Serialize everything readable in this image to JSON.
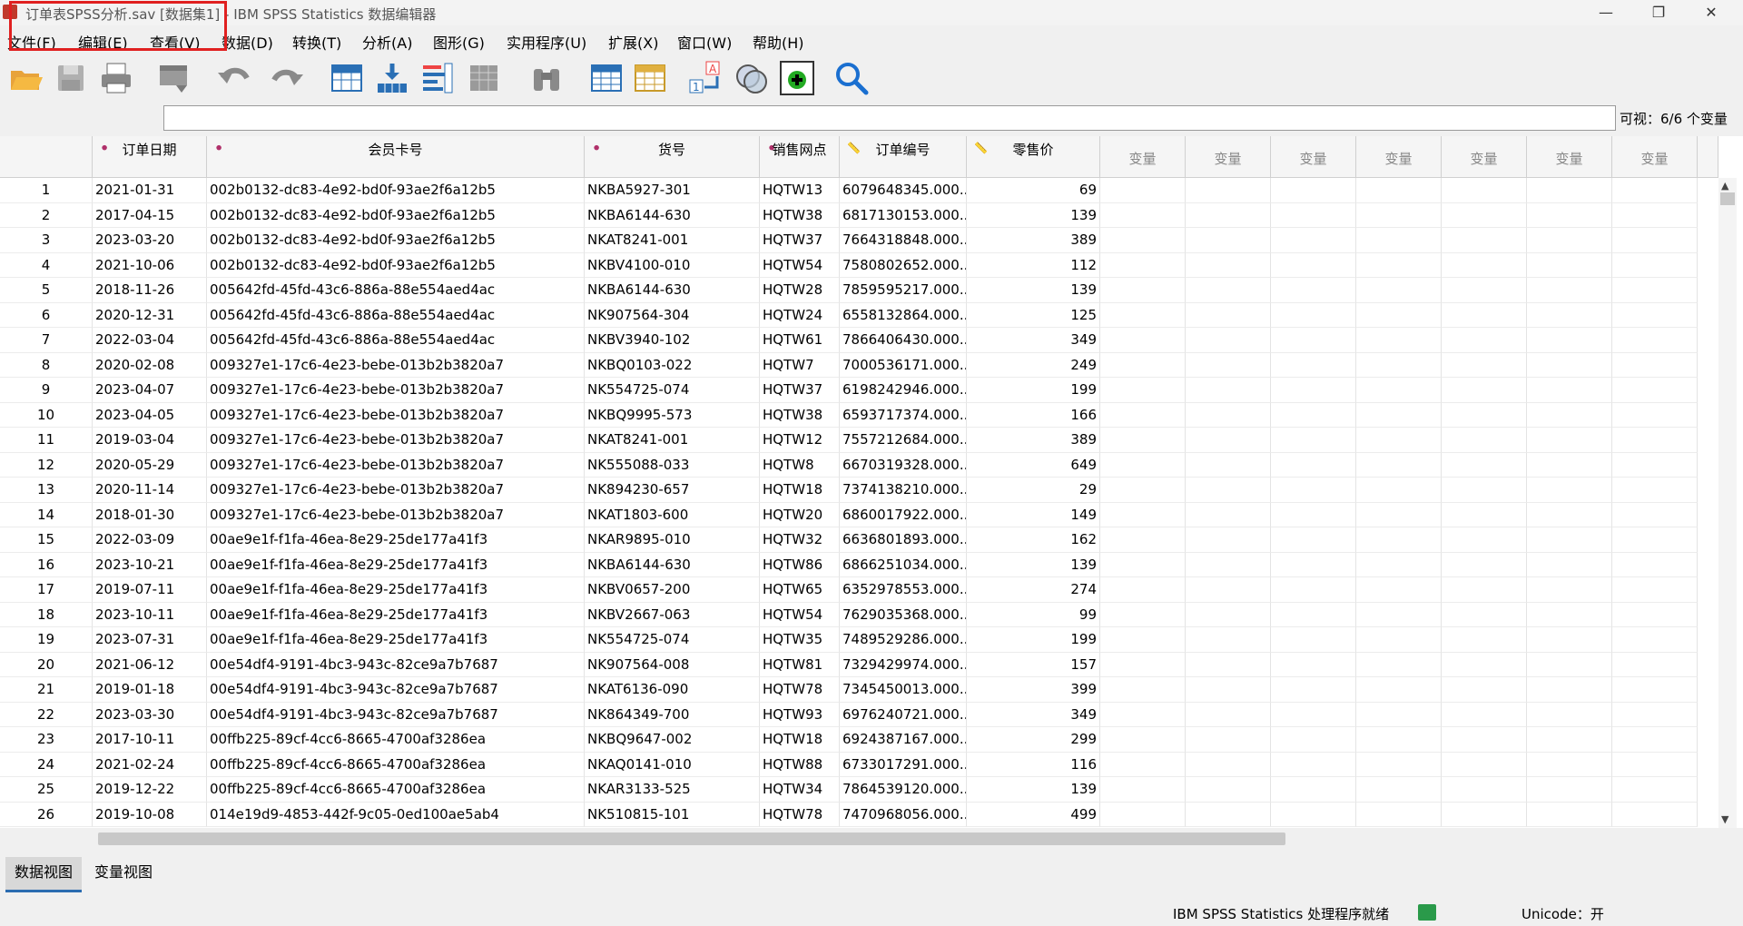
{
  "window": {
    "title": "订单表SPSS分析.sav [数据集1] - IBM SPSS Statistics 数据编辑器",
    "min": "—",
    "restore": "❐",
    "close": "✕"
  },
  "menu": [
    "文件(F)",
    "编辑(E)",
    "查看(V)",
    "数据(D)",
    "转换(T)",
    "分析(A)",
    "图形(G)",
    "实用程序(U)",
    "扩展(X)",
    "窗口(W)",
    "帮助(H)"
  ],
  "toolbar_icons": [
    "open-icon",
    "save-icon",
    "print-icon",
    "dialog-recall-icon",
    "undo-icon",
    "redo-icon",
    "goto-case-icon",
    "goto-variable-icon",
    "variables-icon",
    "run-descriptives-icon",
    "find-icon",
    "insert-cases-icon",
    "insert-variable-icon",
    "value-labels-icon",
    "split-file-icon",
    "use-sets-icon",
    "search-icon"
  ],
  "visible_count": "可视：6/6 个变量",
  "columns": [
    {
      "name": "订单日期",
      "type": "nominal"
    },
    {
      "name": "会员卡号",
      "type": "nominal"
    },
    {
      "name": "货号",
      "type": "nominal"
    },
    {
      "name": "销售网点",
      "type": "nominal"
    },
    {
      "name": "订单编号",
      "type": "scale"
    },
    {
      "name": "零售价",
      "type": "scale"
    }
  ],
  "empty_column_label": "变量",
  "rows": [
    [
      "1",
      "2021-01-31",
      "002b0132-dc83-4e92-bd0f-93ae2f6a12b5",
      "NKBA5927-301",
      "HQTW13",
      "6079648345.000...",
      "69"
    ],
    [
      "2",
      "2017-04-15",
      "002b0132-dc83-4e92-bd0f-93ae2f6a12b5",
      "NKBA6144-630",
      "HQTW38",
      "6817130153.000...",
      "139"
    ],
    [
      "3",
      "2023-03-20",
      "002b0132-dc83-4e92-bd0f-93ae2f6a12b5",
      "NKAT8241-001",
      "HQTW37",
      "7664318848.000...",
      "389"
    ],
    [
      "4",
      "2021-10-06",
      "002b0132-dc83-4e92-bd0f-93ae2f6a12b5",
      "NKBV4100-010",
      "HQTW54",
      "7580802652.000...",
      "112"
    ],
    [
      "5",
      "2018-11-26",
      "005642fd-45fd-43c6-886a-88e554aed4ac",
      "NKBA6144-630",
      "HQTW28",
      "7859595217.000...",
      "139"
    ],
    [
      "6",
      "2020-12-31",
      "005642fd-45fd-43c6-886a-88e554aed4ac",
      "NK907564-304",
      "HQTW24",
      "6558132864.000...",
      "125"
    ],
    [
      "7",
      "2022-03-04",
      "005642fd-45fd-43c6-886a-88e554aed4ac",
      "NKBV3940-102",
      "HQTW61",
      "7866406430.000...",
      "349"
    ],
    [
      "8",
      "2020-02-08",
      "009327e1-17c6-4e23-bebe-013b2b3820a7",
      "NKBQ0103-022",
      "HQTW7",
      "7000536171.000...",
      "249"
    ],
    [
      "9",
      "2023-04-07",
      "009327e1-17c6-4e23-bebe-013b2b3820a7",
      "NK554725-074",
      "HQTW37",
      "6198242946.000...",
      "199"
    ],
    [
      "10",
      "2023-04-05",
      "009327e1-17c6-4e23-bebe-013b2b3820a7",
      "NKBQ9995-573",
      "HQTW38",
      "6593717374.000...",
      "166"
    ],
    [
      "11",
      "2019-03-04",
      "009327e1-17c6-4e23-bebe-013b2b3820a7",
      "NKAT8241-001",
      "HQTW12",
      "7557212684.000...",
      "389"
    ],
    [
      "12",
      "2020-05-29",
      "009327e1-17c6-4e23-bebe-013b2b3820a7",
      "NK555088-033",
      "HQTW8",
      "6670319328.000...",
      "649"
    ],
    [
      "13",
      "2020-11-14",
      "009327e1-17c6-4e23-bebe-013b2b3820a7",
      "NK894230-657",
      "HQTW18",
      "7374138210.000...",
      "29"
    ],
    [
      "14",
      "2018-01-30",
      "009327e1-17c6-4e23-bebe-013b2b3820a7",
      "NKAT1803-600",
      "HQTW20",
      "6860017922.000...",
      "149"
    ],
    [
      "15",
      "2022-03-09",
      "00ae9e1f-f1fa-46ea-8e29-25de177a41f3",
      "NKAR9895-010",
      "HQTW32",
      "6636801893.000...",
      "162"
    ],
    [
      "16",
      "2023-10-21",
      "00ae9e1f-f1fa-46ea-8e29-25de177a41f3",
      "NKBA6144-630",
      "HQTW86",
      "6866251034.000...",
      "139"
    ],
    [
      "17",
      "2019-07-11",
      "00ae9e1f-f1fa-46ea-8e29-25de177a41f3",
      "NKBV0657-200",
      "HQTW65",
      "6352978553.000...",
      "274"
    ],
    [
      "18",
      "2023-10-11",
      "00ae9e1f-f1fa-46ea-8e29-25de177a41f3",
      "NKBV2667-063",
      "HQTW54",
      "7629035368.000...",
      "99"
    ],
    [
      "19",
      "2023-07-31",
      "00ae9e1f-f1fa-46ea-8e29-25de177a41f3",
      "NK554725-074",
      "HQTW35",
      "7489529286.000...",
      "199"
    ],
    [
      "20",
      "2021-06-12",
      "00e54df4-9191-4bc3-943c-82ce9a7b7687",
      "NK907564-008",
      "HQTW81",
      "7329429974.000...",
      "157"
    ],
    [
      "21",
      "2019-01-18",
      "00e54df4-9191-4bc3-943c-82ce9a7b7687",
      "NKAT6136-090",
      "HQTW78",
      "7345450013.000...",
      "399"
    ],
    [
      "22",
      "2023-03-30",
      "00e54df4-9191-4bc3-943c-82ce9a7b7687",
      "NK864349-700",
      "HQTW93",
      "6976240721.000...",
      "349"
    ],
    [
      "23",
      "2017-10-11",
      "00ffb225-89cf-4cc6-8665-4700af3286ea",
      "NKBQ9647-002",
      "HQTW18",
      "6924387167.000...",
      "299"
    ],
    [
      "24",
      "2021-02-24",
      "00ffb225-89cf-4cc6-8665-4700af3286ea",
      "NKAQ0141-010",
      "HQTW88",
      "6733017291.000...",
      "116"
    ],
    [
      "25",
      "2019-12-22",
      "00ffb225-89cf-4cc6-8665-4700af3286ea",
      "NKAR3133-525",
      "HQTW34",
      "7864539120.000...",
      "139"
    ],
    [
      "26",
      "2019-10-08",
      "014e19d9-4853-442f-9c05-0ed100ae5ab4",
      "NK510815-101",
      "HQTW78",
      "7470968056.000...",
      "499"
    ]
  ],
  "tabs": {
    "data_view": "数据视图",
    "variable_view": "变量视图"
  },
  "status": {
    "processor": "IBM SPSS Statistics 处理程序就绪",
    "unicode": "Unicode：开"
  }
}
